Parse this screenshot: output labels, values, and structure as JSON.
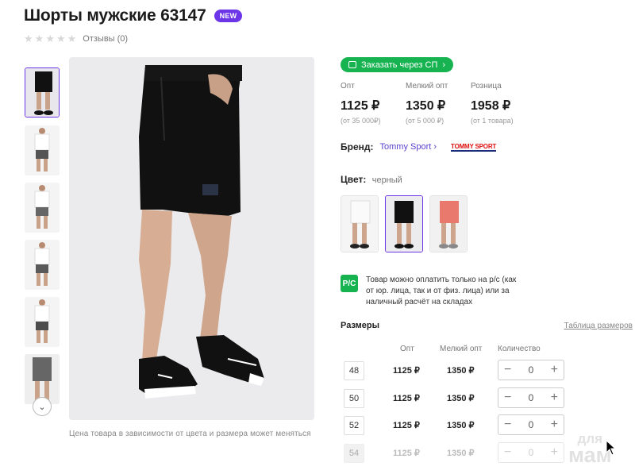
{
  "product": {
    "title": "Шорты мужские 63147",
    "badge": "NEW",
    "reviews": "Отзывы (0)",
    "rating_stars": 0,
    "price_note": "Цена товара в зависимости от цвета и размера может меняться"
  },
  "order_button": {
    "label": "Заказать через СП"
  },
  "prices": [
    {
      "label": "Опт",
      "value": "1125 ₽",
      "sub": "(от 35 000₽)"
    },
    {
      "label": "Мелкий опт",
      "value": "1350 ₽",
      "sub": "(от 5 000 ₽)"
    },
    {
      "label": "Розница",
      "value": "1958 ₽",
      "sub": "(от 1 товара)"
    }
  ],
  "brand": {
    "label": "Бренд:",
    "name": "Tommy Sport",
    "logo_text": "TOMMY SPORT"
  },
  "color": {
    "label": "Цвет:",
    "value": "черный"
  },
  "payment": {
    "icon_text": "Р/С",
    "text": "Товар можно оплатить только на р/с (как от юр. лица, так и от физ. лица) или за наличный расчёт на складах"
  },
  "sizes": {
    "title": "Размеры",
    "table_link": "Таблица размеров",
    "headers": {
      "opt": "Опт",
      "small": "Мелкий опт",
      "qty": "Количество"
    },
    "rows": [
      {
        "size": "48",
        "opt": "1125 ₽",
        "small": "1350 ₽",
        "qty": "0",
        "available": true
      },
      {
        "size": "50",
        "opt": "1125 ₽",
        "small": "1350 ₽",
        "qty": "0",
        "available": true
      },
      {
        "size": "52",
        "opt": "1125 ₽",
        "small": "1350 ₽",
        "qty": "0",
        "available": true
      },
      {
        "size": "54",
        "opt": "1125 ₽",
        "small": "1350 ₽",
        "qty": "0",
        "available": false
      }
    ]
  },
  "watermark": {
    "line1": "для",
    "line2": "мам"
  },
  "colors": {
    "accent": "#6d35e8",
    "green": "#17b350"
  }
}
